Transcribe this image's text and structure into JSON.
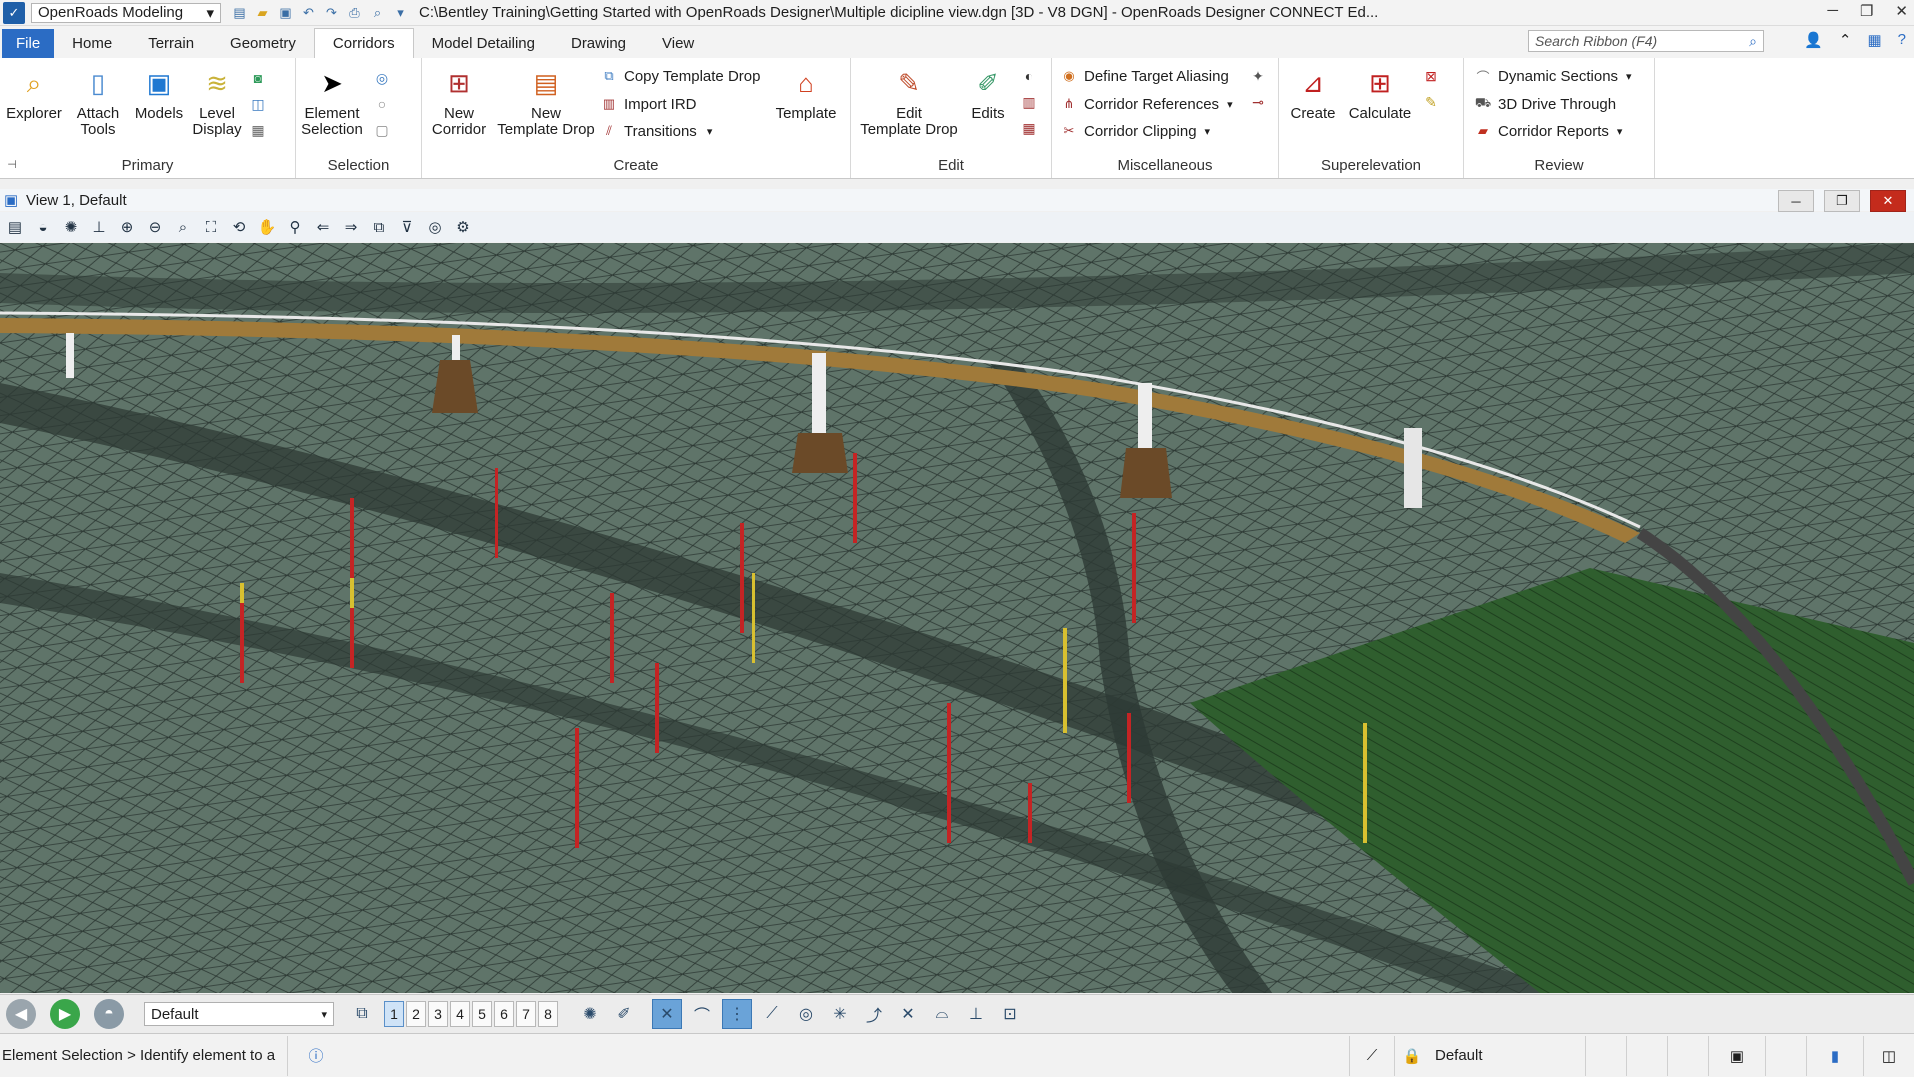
{
  "titlebar": {
    "workflow": "OpenRoads Modeling",
    "document_title": "C:\\Bentley Training\\Getting Started with OpenRoads Designer\\Multiple dicipline view.dgn [3D - V8 DGN] - OpenRoads Designer CONNECT Ed..."
  },
  "tabs": [
    "File",
    "Home",
    "Terrain",
    "Geometry",
    "Corridors",
    "Model Detailing",
    "Drawing",
    "View"
  ],
  "active_tab": "Corridors",
  "search": {
    "placeholder": "Search Ribbon (F4)"
  },
  "ribbon": {
    "primary": {
      "label": "Primary",
      "explorer": "Explorer",
      "attach_tools": "Attach\nTools",
      "models": "Models",
      "level_display": "Level\nDisplay"
    },
    "selection": {
      "label": "Selection",
      "element_selection": "Element\nSelection"
    },
    "create": {
      "label": "Create",
      "new_corridor": "New\nCorridor",
      "new_template_drop": "New\nTemplate Drop",
      "copy_template_drop": "Copy Template Drop",
      "import_ird": "Import IRD",
      "transitions": "Transitions",
      "template": "Template"
    },
    "edit": {
      "label": "Edit",
      "edit_template_drop": "Edit\nTemplate Drop",
      "edits": "Edits"
    },
    "misc": {
      "label": "Miscellaneous",
      "define_target_aliasing": "Define Target Aliasing",
      "corridor_references": "Corridor References",
      "corridor_clipping": "Corridor Clipping"
    },
    "superelevation": {
      "label": "Superelevation",
      "create": "Create",
      "calculate": "Calculate"
    },
    "review": {
      "label": "Review",
      "dynamic_sections": "Dynamic Sections",
      "drive_through": "3D Drive Through",
      "corridor_reports": "Corridor Reports"
    }
  },
  "view": {
    "title": "View 1, Default"
  },
  "bottom": {
    "view_group": "Default",
    "view_numbers": [
      "1",
      "2",
      "3",
      "4",
      "5",
      "6",
      "7",
      "8"
    ],
    "active_view": "1"
  },
  "status": {
    "prompt": "Element Selection > Identify element to a",
    "level": "Default"
  },
  "colors": {
    "file_tab": "#2b6cc4",
    "terrain": "#5e7268",
    "grass": "#2f5e2e",
    "bridge_deck": "#a07a3a",
    "boring_red": "#c42424",
    "boring_yellow": "#d8c030"
  }
}
